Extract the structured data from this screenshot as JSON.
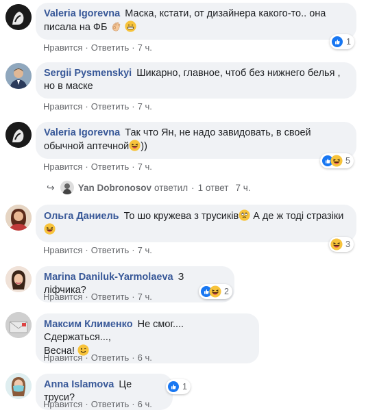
{
  "actions": {
    "like": "Нравится",
    "reply": "Ответить",
    "dot": "·"
  },
  "comments": [
    {
      "author": "Valeria Igorevna",
      "text": "Маска, кстати, от дизайнера какого-то.. она писала на ФБ",
      "time": "7 ч.",
      "reactions": "1"
    },
    {
      "author": "Sergii Pysmenskyi",
      "text": "Шикарно, главное, чтоб без нижнего белья , но в маске",
      "time": "7 ч."
    },
    {
      "author": "Valeria Igorevna",
      "text_line1": "Так что Ян, не надо завидовать, в своей",
      "text_line2": "обычной аптечной",
      "text_tail": "))",
      "time": "7 ч.",
      "reactions": "5"
    },
    {
      "author": "Ольга Даниель",
      "text": "То шо кружева з трусиків",
      "text_tail": "А де ж тоді стразіки",
      "time": "7 ч.",
      "reactions": "3"
    },
    {
      "author": "Marina Daniluk-Yarmolaeva",
      "text": "З ліфчика?",
      "time": "7 ч.",
      "reactions": "2"
    },
    {
      "author": "Максим Клименко",
      "text_line1": "Не смог.... Сдержаться...,",
      "text_line2": "Весна!",
      "time": "6 ч."
    },
    {
      "author": "Anna Islamova",
      "text": "Це труси?",
      "time": "6 ч.",
      "reactions": "1"
    }
  ],
  "reply_thread": {
    "author": "Yan Dobronosov",
    "verb": "ответил",
    "count": "1 ответ",
    "time": "7 ч."
  },
  "colors": {
    "author": "#385898",
    "bubble": "#f0f2f5",
    "like": "#1877f2",
    "haha": "#f7b125",
    "meta": "#65676b"
  }
}
